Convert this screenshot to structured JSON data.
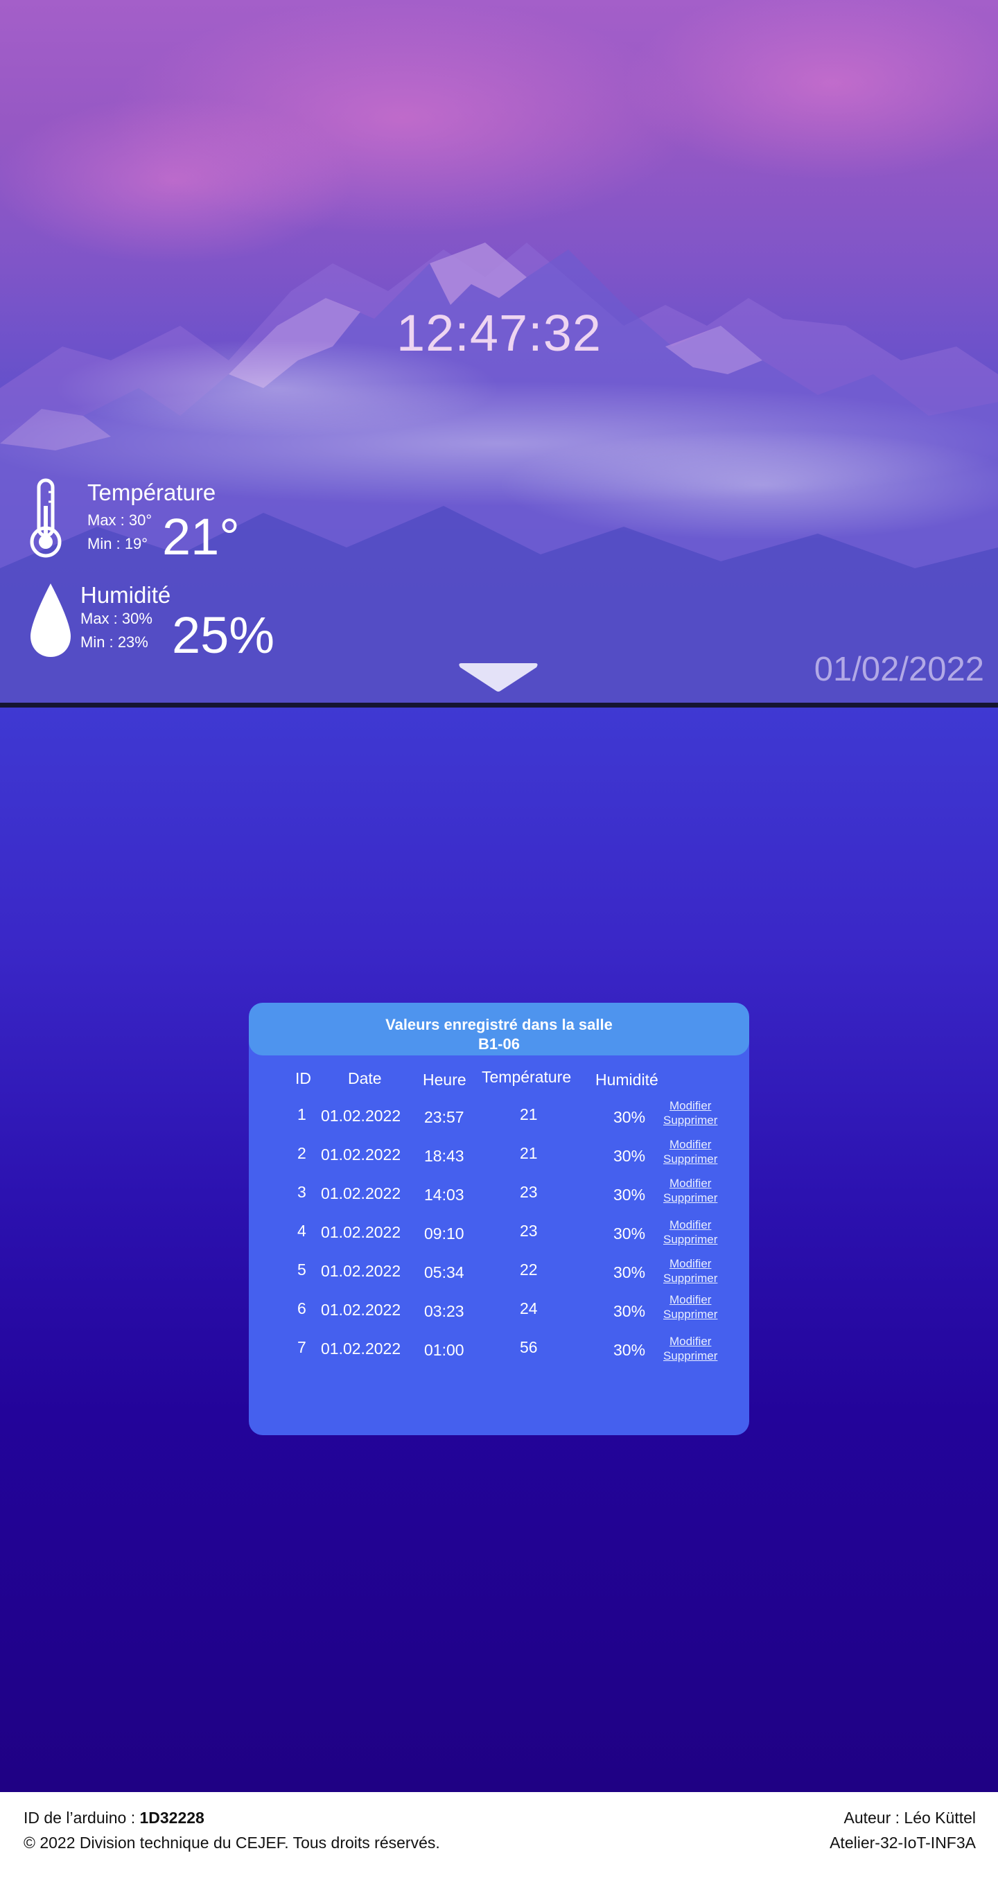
{
  "clock": "12:47:32",
  "date": "01/02/2022",
  "temperature": {
    "title": "Température",
    "max_label": "Max :",
    "max_value": "30°",
    "min_label": "Min  :",
    "min_value": "19°",
    "current": "21°"
  },
  "humidity": {
    "title": "Humidité",
    "max_label": "Max :",
    "max_value": "30%",
    "min_label": "Min  :",
    "min_value": "23%",
    "current": "25%"
  },
  "table": {
    "title_line1": "Valeurs enregistré dans la salle",
    "title_line2": "B1-06",
    "headers": [
      "ID",
      "Date",
      "Heure",
      "Température",
      "Humidité"
    ],
    "edit_label": "Modifier",
    "delete_label": "Supprimer",
    "rows": [
      {
        "id": "1",
        "date": "01.02.2022",
        "time": "23:57",
        "temp": "21",
        "hum": "30%"
      },
      {
        "id": "2",
        "date": "01.02.2022",
        "time": "18:43",
        "temp": "21",
        "hum": "30%"
      },
      {
        "id": "3",
        "date": "01.02.2022",
        "time": "14:03",
        "temp": "23",
        "hum": "30%"
      },
      {
        "id": "4",
        "date": "01.02.2022",
        "time": "09:10",
        "temp": "23",
        "hum": "30%"
      },
      {
        "id": "5",
        "date": "01.02.2022",
        "time": "05:34",
        "temp": "22",
        "hum": "30%"
      },
      {
        "id": "6",
        "date": "01.02.2022",
        "time": "03:23",
        "temp": "24",
        "hum": "30%"
      },
      {
        "id": "7",
        "date": "01.02.2022",
        "time": "01:00",
        "temp": "56",
        "hum": "30%"
      }
    ]
  },
  "footer": {
    "arduino_label": "ID de l’arduino : ",
    "arduino_id": "1D32228",
    "copyright": "© 2022 Division technique du CEJEF. Tous droits réservés.",
    "author": "Auteur : Léo Küttel",
    "project": "Atelier-32-IoT-INF3A"
  }
}
